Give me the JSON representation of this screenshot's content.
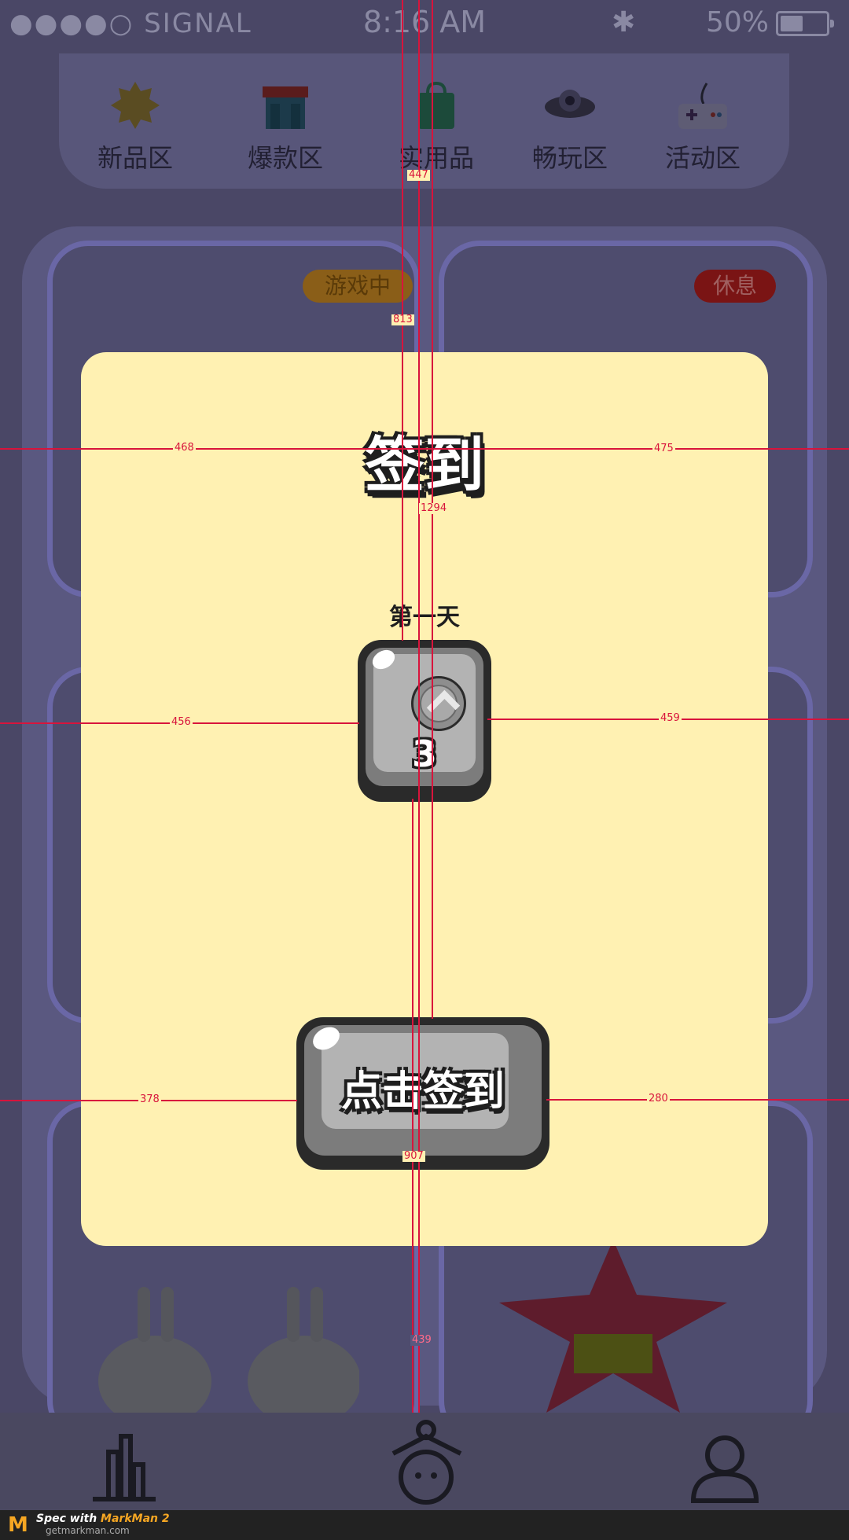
{
  "status_bar": {
    "signal_text": "●●●●○ SIGNAL",
    "time": "8:16 AM",
    "bluetooth": "✱",
    "battery_percent": "50%",
    "battery_level": 0.5
  },
  "categories": [
    {
      "label": "新品区",
      "icon": "sun-icon"
    },
    {
      "label": "爆款区",
      "icon": "shop-icon"
    },
    {
      "label": "实用品",
      "icon": "shopping-bag-icon"
    },
    {
      "label": "畅玩区",
      "icon": "ufo-icon"
    },
    {
      "label": "活动区",
      "icon": "gamepad-icon"
    }
  ],
  "products": [
    {
      "status": "游戏中",
      "status_color": "#a06a10"
    },
    {
      "status": "休息",
      "status_color": "#9c1010"
    }
  ],
  "modal": {
    "title": "签到",
    "day_label": "第一天",
    "reward_amount": "3",
    "reward_icon": "coin-icon",
    "button_label": "点击签到"
  },
  "measurements": [
    "447",
    "813",
    "468",
    "475",
    "1294",
    "456",
    "459",
    "378",
    "280",
    "907",
    "439"
  ],
  "bottom_nav": [
    {
      "icon": "ranking-icon"
    },
    {
      "icon": "claw-machine-icon"
    },
    {
      "icon": "profile-icon"
    }
  ],
  "footer": {
    "spec_prefix": "Spec with ",
    "spec_brand": "MarkMan 2",
    "url": "getmarkman.com",
    "logo": "M"
  },
  "colors": {
    "modal_bg": "#fff1b2",
    "button_gray": "#b3b3b3",
    "measure_red": "#d8143c"
  }
}
